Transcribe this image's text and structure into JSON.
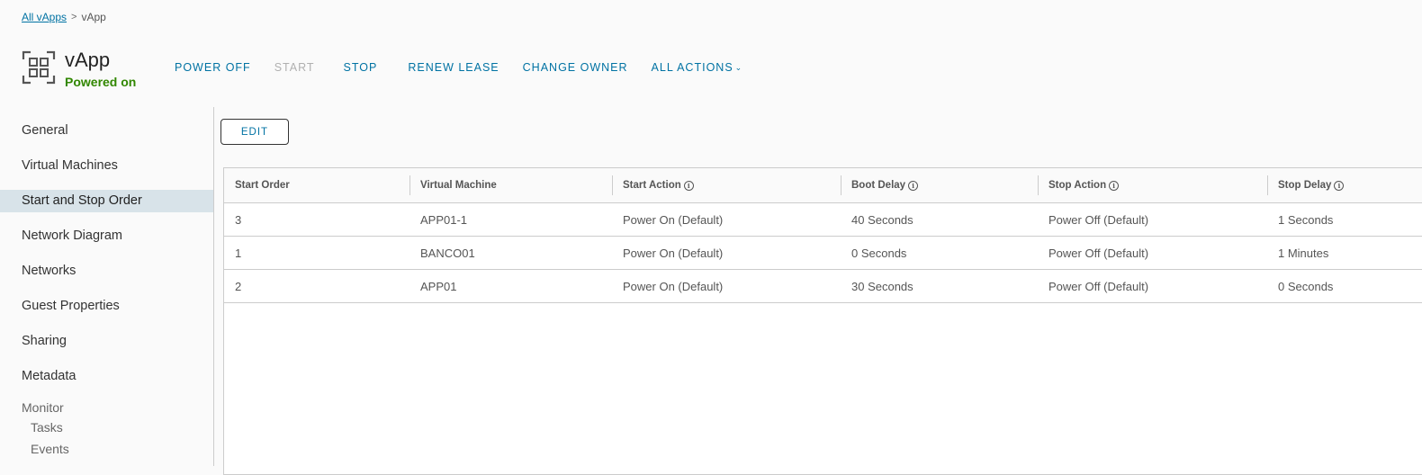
{
  "breadcrumb": {
    "parent": "All vApps",
    "separator": ">",
    "current": "vApp"
  },
  "header": {
    "title": "vApp",
    "status": "Powered on",
    "status_color": "#318700",
    "icon": "vapp-icon"
  },
  "actions": {
    "power_off": "POWER OFF",
    "start": "START",
    "stop": "STOP",
    "renew_lease": "RENEW LEASE",
    "change_owner": "CHANGE OWNER",
    "all_actions": "ALL ACTIONS"
  },
  "sidebar": {
    "items": [
      {
        "label": "General"
      },
      {
        "label": "Virtual Machines"
      },
      {
        "label": "Start and Stop Order",
        "active": true
      },
      {
        "label": "Network Diagram"
      },
      {
        "label": "Networks"
      },
      {
        "label": "Guest Properties"
      },
      {
        "label": "Sharing"
      },
      {
        "label": "Metadata"
      }
    ],
    "monitor": {
      "label": "Monitor",
      "items": [
        {
          "label": "Tasks"
        },
        {
          "label": "Events"
        }
      ]
    }
  },
  "edit_button": "EDIT",
  "table": {
    "columns": [
      "Start Order",
      "Virtual Machine",
      "Start Action",
      "Boot Delay",
      "Stop Action",
      "Stop Delay"
    ],
    "rows": [
      [
        "3",
        "APP01-1",
        "Power On (Default)",
        "40 Seconds",
        "Power Off (Default)",
        "1 Seconds"
      ],
      [
        "1",
        "BANCO01",
        "Power On (Default)",
        "0 Seconds",
        "Power Off (Default)",
        "1 Minutes"
      ],
      [
        "2",
        "APP01",
        "Power On (Default)",
        "30 Seconds",
        "Power Off (Default)",
        "0 Seconds"
      ]
    ]
  },
  "colors": {
    "accent": "#0072a3",
    "active_nav": "#d8e3e9"
  }
}
